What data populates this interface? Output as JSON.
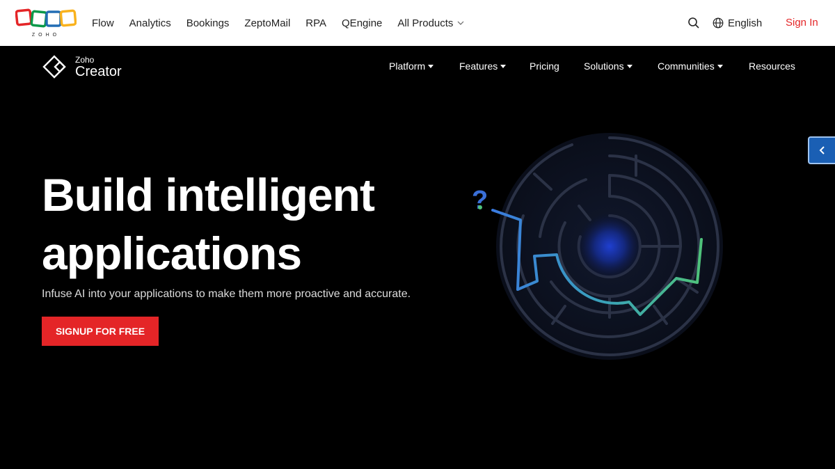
{
  "topbar": {
    "nav": [
      {
        "label": "Flow"
      },
      {
        "label": "Analytics"
      },
      {
        "label": "Bookings"
      },
      {
        "label": "ZeptoMail"
      },
      {
        "label": "RPA"
      },
      {
        "label": "QEngine"
      },
      {
        "label": "All Products"
      }
    ],
    "language": "English",
    "signin": "Sign In",
    "logo_text": "ZOHO"
  },
  "creator": {
    "logo_small": "Zoho",
    "logo_large": "Creator",
    "nav": [
      {
        "label": "Platform"
      },
      {
        "label": "Features"
      },
      {
        "label": "Pricing"
      },
      {
        "label": "Solutions"
      },
      {
        "label": "Communities"
      },
      {
        "label": "Resources"
      }
    ]
  },
  "hero": {
    "title_line1": "Build intelligent",
    "title_line2": "applications",
    "subtitle": "Infuse AI into your applications to make them more proactive and accurate.",
    "cta": "SIGNUP FOR FREE",
    "question_mark": "?"
  },
  "colors": {
    "accent_red": "#e42527",
    "side_tab_blue": "#1a5fb4"
  }
}
